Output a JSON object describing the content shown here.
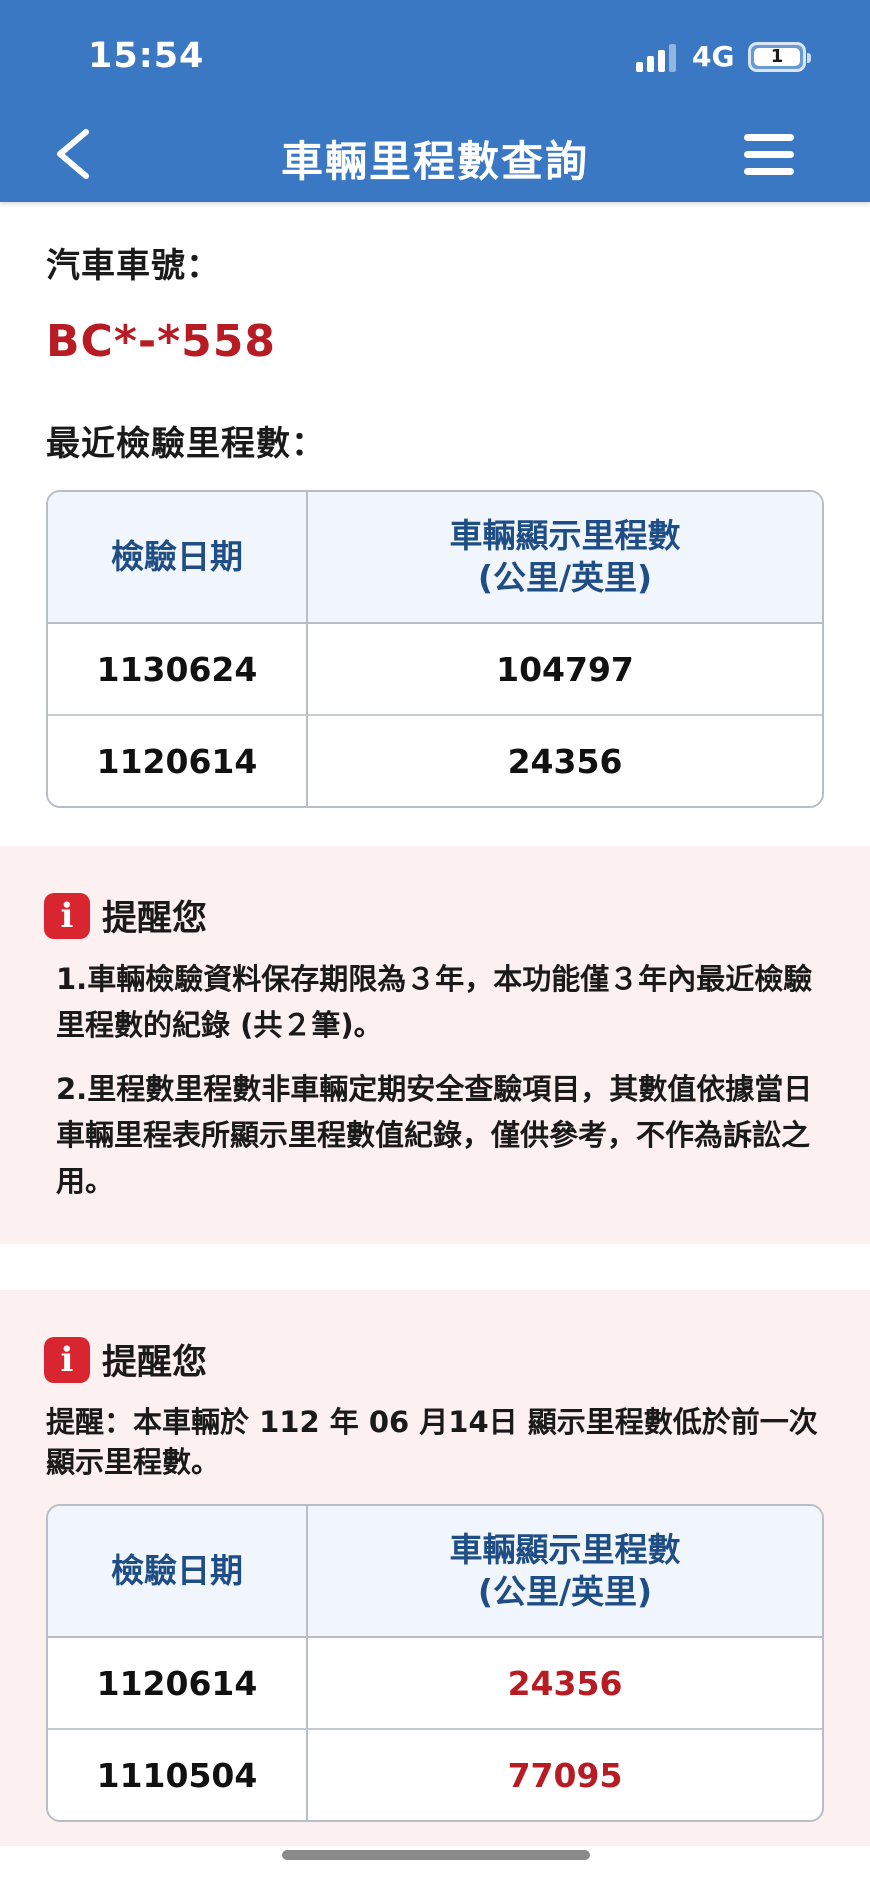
{
  "status": {
    "time": "15:54",
    "network": "4G",
    "battery": "1"
  },
  "header": {
    "title": "車輛里程數查詢",
    "back_icon": "chevron-left-icon",
    "menu_icon": "hamburger-icon"
  },
  "vehicle": {
    "plate_label": "汽車車號：",
    "plate": "BC*-*558"
  },
  "recent": {
    "label": "最近檢驗里程數：",
    "columns": [
      "檢驗日期",
      "車輛顯示里程數",
      "(公里/英里)"
    ],
    "rows": [
      {
        "date": "1130624",
        "mileage": "104797"
      },
      {
        "date": "1120614",
        "mileage": "24356"
      }
    ]
  },
  "notice1": {
    "title": "提醒您",
    "items": [
      "1.車輛檢驗資料保存期限為３年，本功能僅３年內最近檢驗里程數的紀錄 (共２筆)。",
      "2.里程數里程數非車輛定期安全查驗項目，其數值依據當日車輛里程表所顯示里程數值紀錄，僅供參考，不作為訴訟之用。"
    ]
  },
  "notice2": {
    "title": "提醒您",
    "text": "提醒：本車輛於 112 年 06 月14日 顯示里程數低於前一次顯示里程數。",
    "columns": [
      "檢驗日期",
      "車輛顯示里程數",
      "(公里/英里)"
    ],
    "rows": [
      {
        "date": "1120614",
        "mileage": "24356"
      },
      {
        "date": "1110504",
        "mileage": "77095"
      }
    ]
  },
  "colors": {
    "header": "#3a78c4",
    "accent_red": "#b71c25",
    "notice_bg": "#fdf0f1",
    "table_head_text": "#1f4e86"
  }
}
